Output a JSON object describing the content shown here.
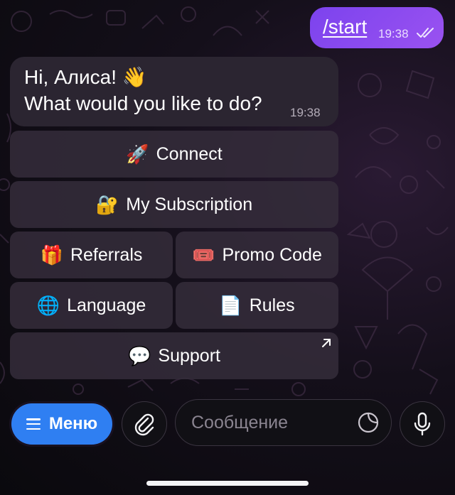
{
  "chat": {
    "outgoing": {
      "text": "/start",
      "time": "19:38"
    },
    "incoming": {
      "line1": "Hi, Алиса! 👋",
      "line2": "What would you like to do?",
      "time": "19:38"
    }
  },
  "keyboard": {
    "connect": {
      "emoji": "🚀",
      "label": "Connect"
    },
    "subscription": {
      "emoji": "🔐",
      "label": "My Subscription"
    },
    "referrals": {
      "emoji": "🎁",
      "label": "Referrals"
    },
    "promo": {
      "emoji": "🎟️",
      "label": "Promo Code"
    },
    "language": {
      "emoji": "🌐",
      "label": "Language"
    },
    "rules": {
      "emoji": "📄",
      "label": "Rules"
    },
    "support": {
      "emoji": "💬",
      "label": "Support"
    }
  },
  "composer": {
    "menu_label": "Меню",
    "placeholder": "Сообщение",
    "icons": [
      "hamburger-icon",
      "paperclip-icon",
      "sticker-icon",
      "microphone-icon"
    ]
  },
  "colors": {
    "outgoing_bubble": "#8a4bef",
    "incoming_bubble": "#2b2531",
    "menu_button": "#2f7ff2",
    "keyboard_button": "#342c3a"
  }
}
